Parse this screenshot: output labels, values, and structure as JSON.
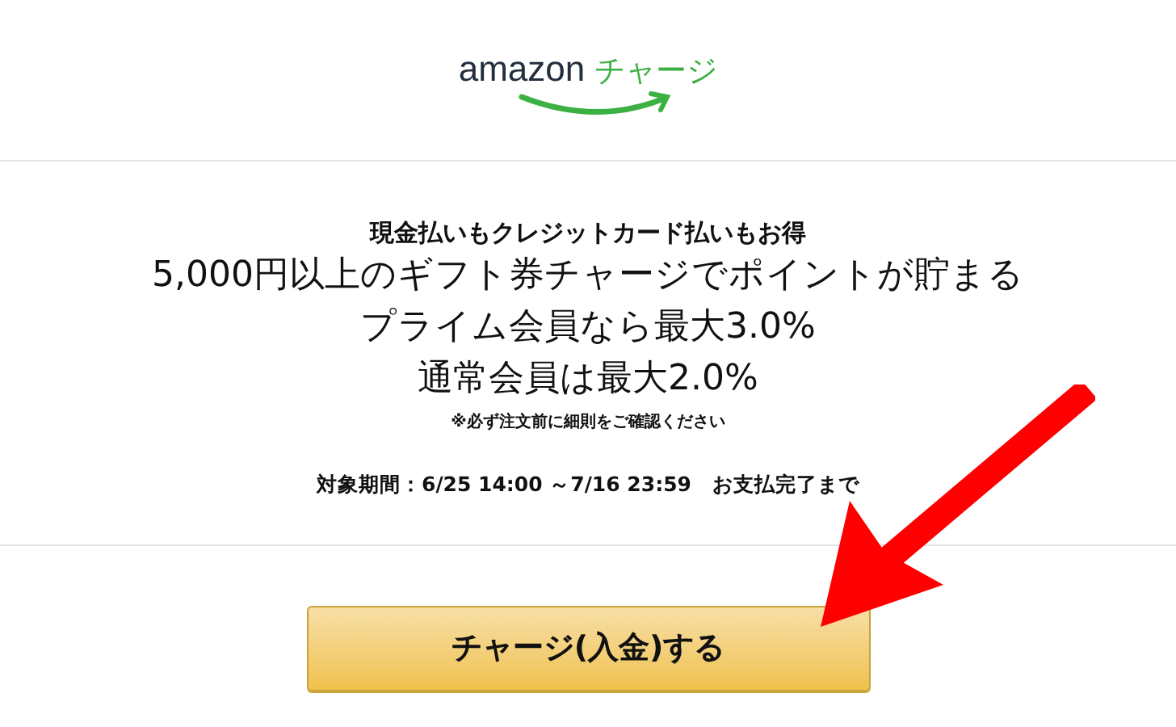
{
  "logo": {
    "wordmark": "amazon",
    "product": "チャージ"
  },
  "promo": {
    "headline": "現金払いもクレジットカード払いもお得",
    "lines": [
      "5,000円以上のギフト券チャージでポイントが貯まる",
      "プライム会員なら最大3.0%",
      "通常会員は最大2.0%"
    ],
    "note": "※必ず注文前に細則をご確認ください",
    "period": "対象期間：6/25 14:00 ～7/16 23:59　お支払完了まで"
  },
  "charge_button": {
    "label": "チャージ(入金)する"
  }
}
